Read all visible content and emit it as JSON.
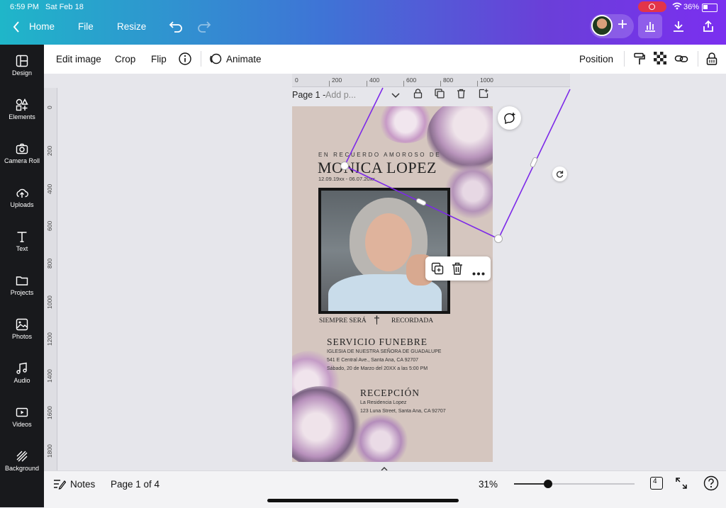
{
  "status": {
    "time": "6:59 PM",
    "date": "Sat Feb 18",
    "battery": "36%"
  },
  "topbar": {
    "home": "Home",
    "file": "File",
    "resize": "Resize"
  },
  "sidebar": [
    {
      "label": "Design",
      "icon": "design-icon"
    },
    {
      "label": "Elements",
      "icon": "elements-icon"
    },
    {
      "label": "Camera Roll",
      "icon": "camera-icon"
    },
    {
      "label": "Uploads",
      "icon": "upload-icon"
    },
    {
      "label": "Text",
      "icon": "text-icon"
    },
    {
      "label": "Projects",
      "icon": "folder-icon"
    },
    {
      "label": "Photos",
      "icon": "photo-icon"
    },
    {
      "label": "Audio",
      "icon": "music-icon"
    },
    {
      "label": "Videos",
      "icon": "video-icon"
    },
    {
      "label": "Background",
      "icon": "background-icon"
    }
  ],
  "toolbar": {
    "edit_image": "Edit image",
    "crop": "Crop",
    "flip": "Flip",
    "animate": "Animate",
    "position": "Position"
  },
  "rulers": {
    "top": [
      "0",
      "200",
      "400",
      "600",
      "800",
      "1000"
    ],
    "left": [
      "0",
      "200",
      "400",
      "600",
      "800",
      "1000",
      "1200",
      "1400",
      "1600",
      "1800"
    ]
  },
  "page_header": {
    "title": "Page 1 -",
    "placeholder": "Add p..."
  },
  "card": {
    "line1": "EN RECUERDO AMOROSO DE",
    "name": "MONICA LOPEZ",
    "dates": "12.09.19xx - 06.07.20xx",
    "motto_left": "SIEMPRE SERÁ",
    "motto_right": "RECORDADA",
    "service_title": "SERVICIO FUNEBRE",
    "service_lines": [
      "IGLESIA DE NUESTRA SEÑORA DE GUADALUPE",
      "541 E Central Ave., Santa Ana, CA 92707",
      "Sábado, 20 de Marzo del 20XX a las 5:00 PM"
    ],
    "reception_title": "RECEPCIÓN",
    "reception_lines": [
      "La Residencia Lopez",
      "123 Luna Street, Santa Ana, CA 92707"
    ]
  },
  "bottombar": {
    "notes": "Notes",
    "page_info": "Page 1 of 4",
    "zoom": "31%",
    "zoom_level": 0.28,
    "page_count": "4"
  },
  "colors": {
    "accent": "#7d2ae8",
    "sidebar": "#18191c",
    "card_bg": "#d5c6bf"
  }
}
